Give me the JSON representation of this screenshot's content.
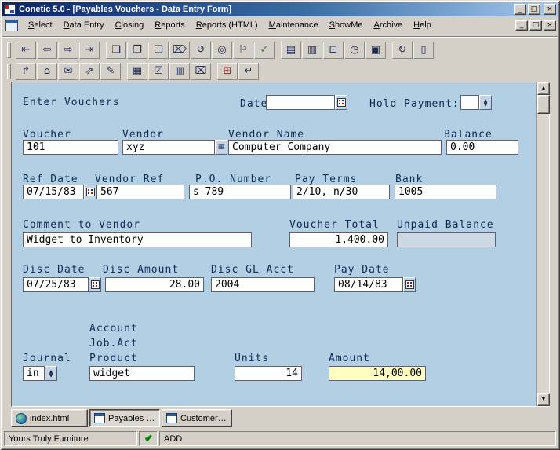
{
  "window": {
    "title": "Conetic 5.0 - [Payables Vouchers - Data Entry Form]"
  },
  "titlebar_controls": {
    "minimize": "_",
    "maximize": "□",
    "close": "×"
  },
  "menu": {
    "items": [
      "Select",
      "Data Entry",
      "Closing",
      "Reports",
      "Reports (HTML)",
      "Maintenance",
      "ShowMe",
      "Archive",
      "Help"
    ],
    "mdi_controls": {
      "minimize": "_",
      "restore": "□",
      "close": "×"
    }
  },
  "toolbar": {
    "row1": [
      {
        "name": "nav-first-icon",
        "glyph": "⇤"
      },
      {
        "name": "nav-prev-icon",
        "glyph": "⇦"
      },
      {
        "name": "nav-next-icon",
        "glyph": "⇨"
      },
      {
        "name": "nav-last-icon",
        "glyph": "⇥"
      },
      {
        "name": "new-record-icon",
        "glyph": "❏"
      },
      {
        "name": "clone-record-icon",
        "glyph": "❐"
      },
      {
        "name": "save-record-icon",
        "glyph": "❑"
      },
      {
        "name": "delete-record-icon",
        "glyph": "⌦"
      },
      {
        "name": "undo-icon",
        "glyph": "↺"
      },
      {
        "name": "find-icon",
        "glyph": "◎"
      },
      {
        "name": "flag-icon",
        "glyph": "⚐"
      },
      {
        "name": "accept-icon",
        "glyph": "✓"
      },
      {
        "name": "copy-icon",
        "glyph": "▤"
      },
      {
        "name": "paste-icon",
        "glyph": "▥"
      },
      {
        "name": "window-switch-icon",
        "glyph": "⊡"
      },
      {
        "name": "clock-icon",
        "glyph": "◷"
      },
      {
        "name": "print-icon",
        "glyph": "▣"
      },
      {
        "name": "refresh-icon",
        "glyph": "↻"
      },
      {
        "name": "report-icon",
        "glyph": "▯"
      }
    ],
    "row2": [
      {
        "name": "page-out-icon",
        "glyph": "↱"
      },
      {
        "name": "home-icon",
        "glyph": "⌂"
      },
      {
        "name": "mail-icon",
        "glyph": "✉"
      },
      {
        "name": "export-icon",
        "glyph": "⇗"
      },
      {
        "name": "edit-pen-icon",
        "glyph": "✎"
      },
      {
        "name": "table-icon",
        "glyph": "▦"
      },
      {
        "name": "table-check-icon",
        "glyph": "☑"
      },
      {
        "name": "table-save-icon",
        "glyph": "▥"
      },
      {
        "name": "trash-icon",
        "glyph": "⌧"
      },
      {
        "name": "grid-add-icon",
        "glyph": "⊞"
      },
      {
        "name": "run-icon",
        "glyph": "↵"
      }
    ]
  },
  "form": {
    "title": "Enter Vouchers",
    "date_label": "Date",
    "date_value": "",
    "hold_payment_label": "Hold Payment:",
    "hold_payment_value": "",
    "voucher_label": "Voucher",
    "voucher_value": "101",
    "vendor_label": "Vendor",
    "vendor_value": "xyz",
    "vendor_name_label": "Vendor Name",
    "vendor_name_value": "Computer Company",
    "balance_label": "Balance",
    "balance_value": "0.00",
    "ref_date_label": "Ref Date",
    "ref_date_value": "07/15/83",
    "vendor_ref_label": "Vendor Ref",
    "vendor_ref_value": "567",
    "po_number_label": "P.O. Number",
    "po_number_value": "s-789",
    "pay_terms_label": "Pay Terms",
    "pay_terms_value": "2/10, n/30",
    "bank_label": "Bank",
    "bank_value": "1005",
    "comment_label": "Comment to Vendor",
    "comment_value": "Widget to Inventory",
    "voucher_total_label": "Voucher Total",
    "voucher_total_value": "1,400.00",
    "unpaid_balance_label": "Unpaid Balance",
    "unpaid_balance_value": "",
    "disc_date_label": "Disc Date",
    "disc_date_value": "07/25/83",
    "disc_amount_label": "Disc Amount",
    "disc_amount_value": "28.00",
    "disc_gl_label": "Disc GL Acct",
    "disc_gl_value": "2004",
    "pay_date_label": "Pay Date",
    "pay_date_value": "08/14/83",
    "account_label": "Account",
    "job_act_label": "Job.Act",
    "journal_label": "Journal",
    "journal_value": "in",
    "product_label": "Product",
    "product_value": "widget",
    "units_label": "Units",
    "units_value": "14",
    "amount_label": "Amount",
    "amount_value": "14,00.00"
  },
  "tabs": [
    {
      "label": "index.html"
    },
    {
      "label": "Payables Vo..."
    },
    {
      "label": "Customers - ..."
    }
  ],
  "statusbar": {
    "company": "Yours Truly Furniture",
    "check": "✔",
    "mode": "ADD"
  }
}
